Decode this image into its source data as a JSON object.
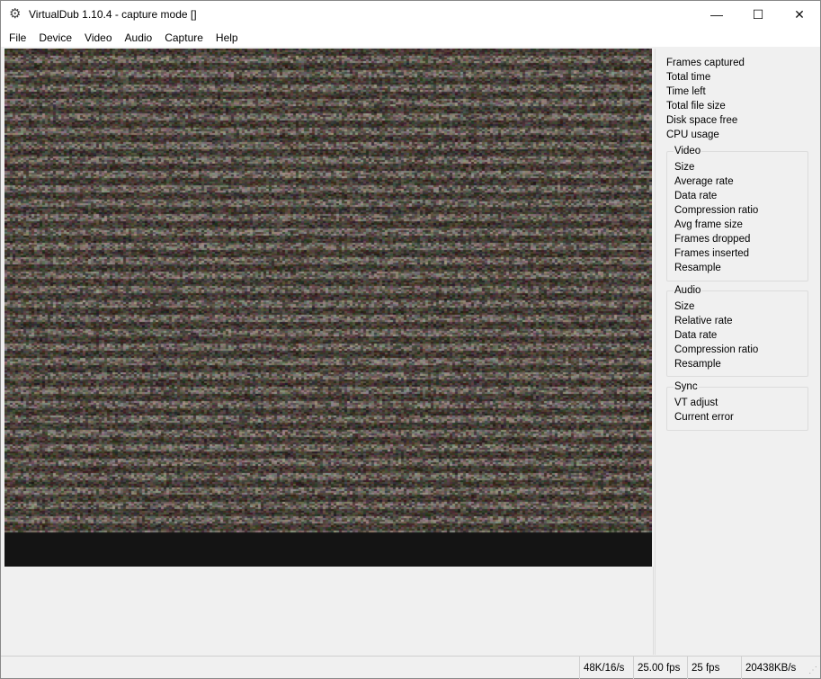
{
  "window": {
    "title": "VirtualDub 1.10.4 - capture mode []",
    "minimize": "—",
    "maximize": "☐",
    "close": "✕"
  },
  "menu": [
    "File",
    "Device",
    "Video",
    "Audio",
    "Capture",
    "Help"
  ],
  "stats": [
    "Frames captured",
    "Total time",
    "Time left",
    "Total file size",
    "Disk space free",
    "CPU usage"
  ],
  "video_group": {
    "title": "Video",
    "items": [
      "Size",
      "Average rate",
      "Data rate",
      "Compression ratio",
      "Avg frame size",
      "Frames dropped",
      "Frames inserted",
      "Resample"
    ]
  },
  "audio_group": {
    "title": "Audio",
    "items": [
      "Size",
      "Relative rate",
      "Data rate",
      "Compression ratio",
      "Resample"
    ]
  },
  "sync_group": {
    "title": "Sync",
    "items": [
      "VT adjust",
      "Current error"
    ]
  },
  "statusbar": [
    "48K/16/s",
    "25.00 fps",
    "25 fps",
    "20438KB/s"
  ]
}
